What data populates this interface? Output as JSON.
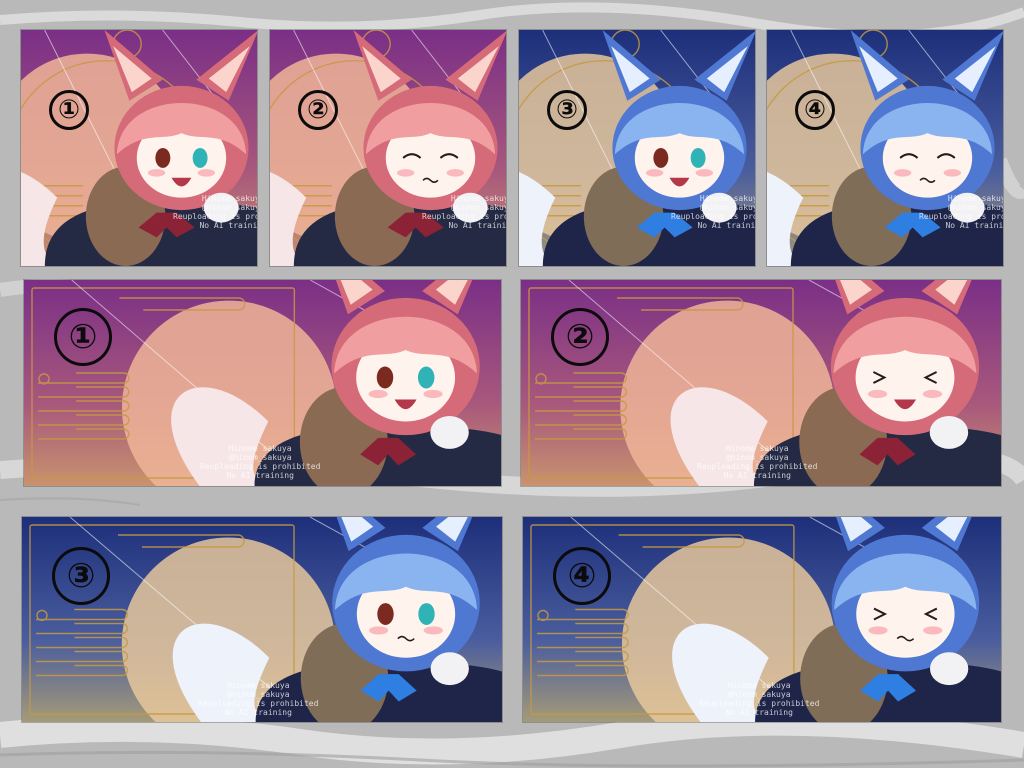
{
  "palettes": {
    "pink": {
      "sky_top": "#7a2f86",
      "sky_mid": "#a8587c",
      "sky_low": "#c8936e",
      "moon": "#efb598",
      "hair": "#f19ea0",
      "hair_dark": "#d56b78",
      "ear_inner": "#fbd4cc",
      "coat": "#252a44",
      "fur": "#8a6a52",
      "scarf": "#8c2236",
      "tail": "#f6e6e8",
      "eye": "#2fb3b7",
      "gold": "#c59a43"
    },
    "blue": {
      "sky_top": "#1d2f7a",
      "sky_mid": "#4a5d9e",
      "sky_low": "#a59a78",
      "moon": "#e6c79b",
      "hair": "#8ab4f0",
      "hair_dark": "#4f78d2",
      "ear_inner": "#e6efff",
      "coat": "#1f2548",
      "fur": "#7f6d58",
      "scarf": "#2f7fe2",
      "tail": "#eef2fb",
      "eye": "#2fb3b7",
      "gold": "#c59a43"
    }
  },
  "panels": [
    {
      "id": "p1",
      "label": "①",
      "palette": "pink",
      "expression": "open",
      "size": "small"
    },
    {
      "id": "p2",
      "label": "②",
      "palette": "pink",
      "expression": "wink",
      "size": "small"
    },
    {
      "id": "p3",
      "label": "③",
      "palette": "blue",
      "expression": "open",
      "size": "small"
    },
    {
      "id": "p4",
      "label": "④",
      "palette": "blue",
      "expression": "wink",
      "size": "small"
    },
    {
      "id": "p5",
      "label": "①",
      "palette": "pink",
      "expression": "open",
      "size": "large"
    },
    {
      "id": "p6",
      "label": "②",
      "palette": "pink",
      "expression": "closed",
      "size": "large"
    },
    {
      "id": "p7",
      "label": "③",
      "palette": "blue",
      "expression": "pout",
      "size": "large"
    },
    {
      "id": "p8",
      "label": "④",
      "palette": "blue",
      "expression": "closed-pout",
      "size": "large"
    }
  ],
  "watermark": {
    "name": "Hinome sakuya",
    "handle": "@hinom_sakuya",
    "note1": "Reuploading is prohibited",
    "note2": "No AI training"
  },
  "colors": {
    "page_background": "#b7b7b7",
    "cloud": "#d9d9d9",
    "cloud_edge": "#9c9c9c",
    "label_ink": "#0b0b0b"
  }
}
